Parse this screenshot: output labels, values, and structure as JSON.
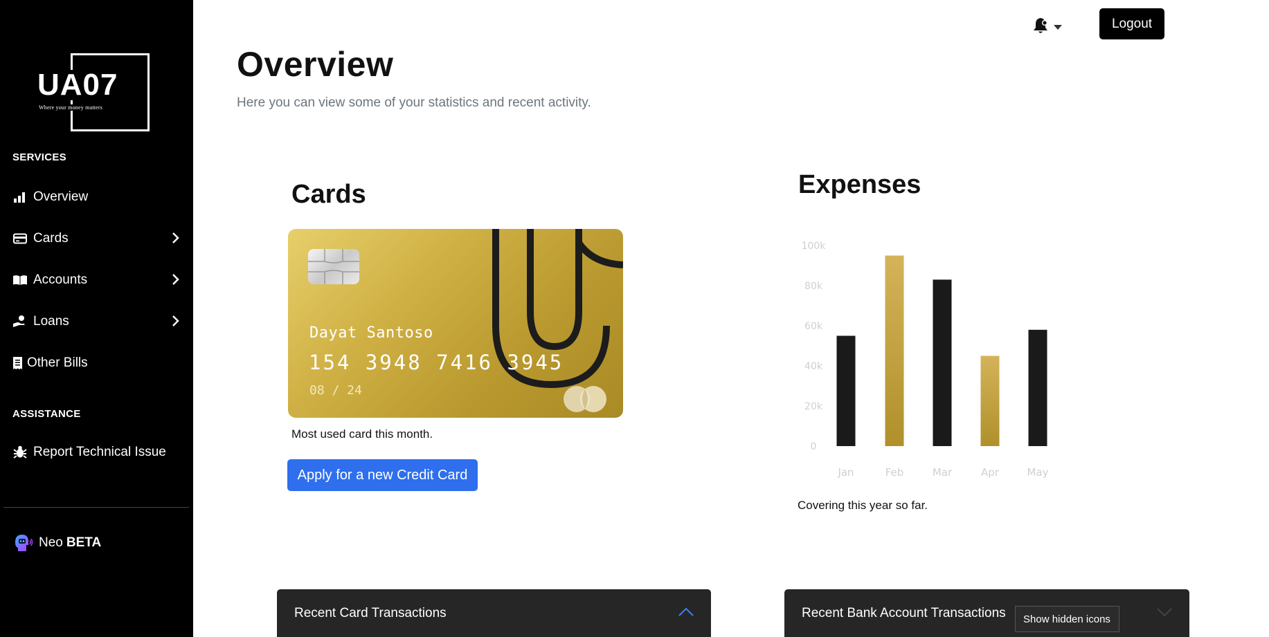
{
  "logo": {
    "text": "UA07",
    "tagline": "Where your money matters"
  },
  "sidebar": {
    "services_title": "SERVICES",
    "items": [
      {
        "label": "Overview",
        "icon": "bar-chart-icon"
      },
      {
        "label": "Cards",
        "icon": "credit-card-icon"
      },
      {
        "label": "Accounts",
        "icon": "book-icon"
      },
      {
        "label": "Loans",
        "icon": "hand-coin-icon"
      },
      {
        "label": "Other Bills",
        "icon": "receipt-icon"
      }
    ],
    "assistance_title": "ASSISTANCE",
    "report_label": "Report Technical Issue",
    "neo_label": "Neo",
    "neo_badge": "BETA"
  },
  "header": {
    "logout_label": "Logout"
  },
  "page": {
    "title": "Overview",
    "subtitle": "Here you can view some of your statistics and recent activity."
  },
  "cards": {
    "heading": "Cards",
    "holder": "Dayat Santoso",
    "number": "154 3948 7416 3945",
    "expiry": "08 / 24",
    "caption": "Most used card this month.",
    "apply_label": "Apply for a new Credit Card"
  },
  "expenses": {
    "heading": "Expenses",
    "caption": "Covering this year so far."
  },
  "chart_data": {
    "type": "bar",
    "categories": [
      "Jan",
      "Feb",
      "Mar",
      "Apr",
      "May"
    ],
    "values": [
      55000,
      95000,
      83000,
      45000,
      58000
    ],
    "ylim": [
      0,
      100000
    ],
    "yticks": [
      "0",
      "20k",
      "40k",
      "60k",
      "80k",
      "100k"
    ],
    "bar_colors": [
      "#1a1a1a",
      "#c3a23c",
      "#1a1a1a",
      "#c3a23c",
      "#1a1a1a"
    ],
    "grid": false,
    "title": "",
    "xlabel": "",
    "ylabel": ""
  },
  "panels": {
    "card_transactions": "Recent Card Transactions",
    "bank_transactions": "Recent Bank Account Transactions"
  },
  "tooltip": {
    "text": "Show hidden icons"
  },
  "colors": {
    "accent_blue": "#2f6fed",
    "gold": "#c3a23c",
    "sidebar_bg": "#000000",
    "panel_bg": "#262626"
  }
}
